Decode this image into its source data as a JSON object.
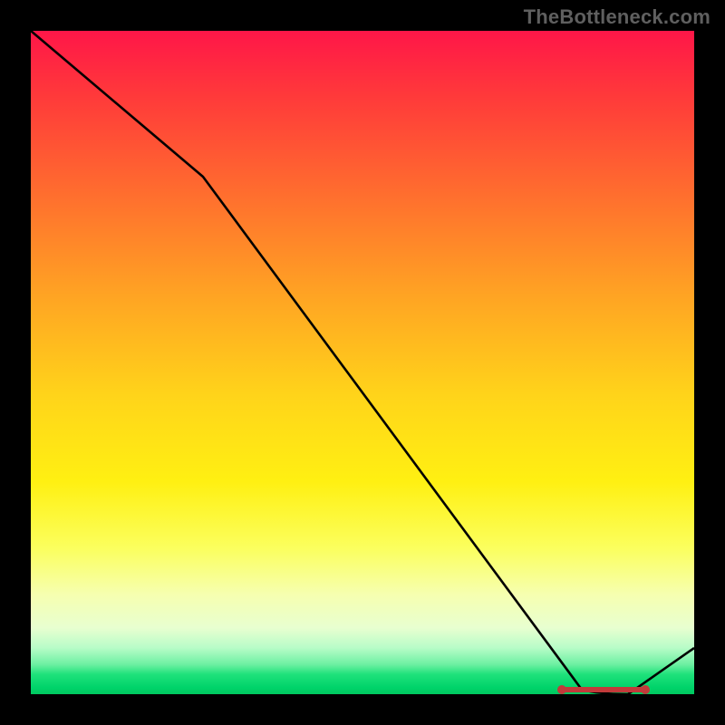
{
  "watermark": "TheBottleneck.com",
  "chart_data": {
    "type": "line",
    "title": "",
    "xlabel": "",
    "ylabel": "",
    "x": [
      0.0,
      0.26,
      0.83,
      0.9,
      1.0
    ],
    "values": [
      1.0,
      0.78,
      0.0,
      0.0,
      0.07
    ],
    "xlim": [
      0,
      1
    ],
    "ylim": [
      0,
      1
    ],
    "marker_segment_x": [
      0.8,
      0.93
    ],
    "background": "heatmap-vertical-gradient",
    "background_gradient_stops": [
      {
        "pct": 0,
        "color": "#ff1648"
      },
      {
        "pct": 55,
        "color": "#ffd41a"
      },
      {
        "pct": 85,
        "color": "#f6ffb0"
      },
      {
        "pct": 100,
        "color": "#00c85f"
      }
    ],
    "legend": false,
    "grid": false
  }
}
